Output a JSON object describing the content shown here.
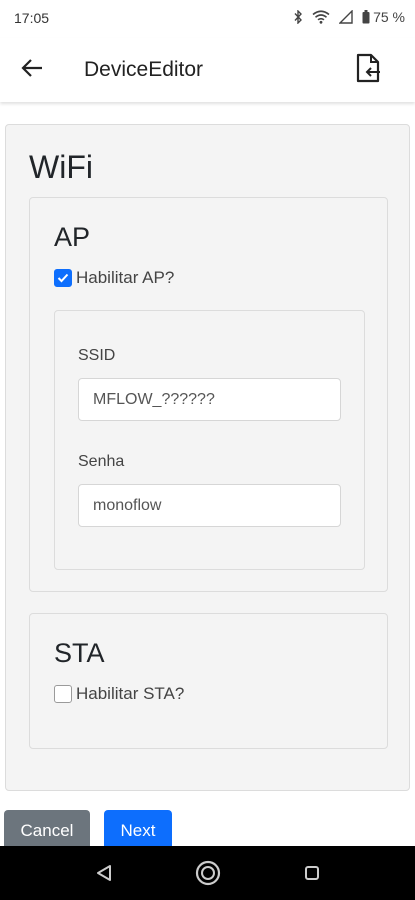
{
  "status_bar": {
    "time": "17:05",
    "battery": "75 %"
  },
  "app_bar": {
    "title": "DeviceEditor"
  },
  "wifi": {
    "title": "WiFi",
    "ap": {
      "title": "AP",
      "enable_label": "Habilitar AP?",
      "enabled": true,
      "ssid_label": "SSID",
      "ssid_value": "MFLOW_??????",
      "password_label": "Senha",
      "password_value": "monoflow"
    },
    "sta": {
      "title": "STA",
      "enable_label": "Habilitar STA?",
      "enabled": false
    }
  },
  "actions": {
    "cancel_label": "Cancel",
    "next_label": "Next"
  },
  "colors": {
    "primary": "#0d6efd",
    "secondary": "#6c757d",
    "panel": "#f4f4f4"
  },
  "icons": [
    "bluetooth-icon",
    "wifi-icon",
    "cellular-signal-icon",
    "battery-icon",
    "back-arrow-icon",
    "file-import-icon",
    "nav-back-icon",
    "nav-home-icon",
    "nav-recents-icon"
  ]
}
